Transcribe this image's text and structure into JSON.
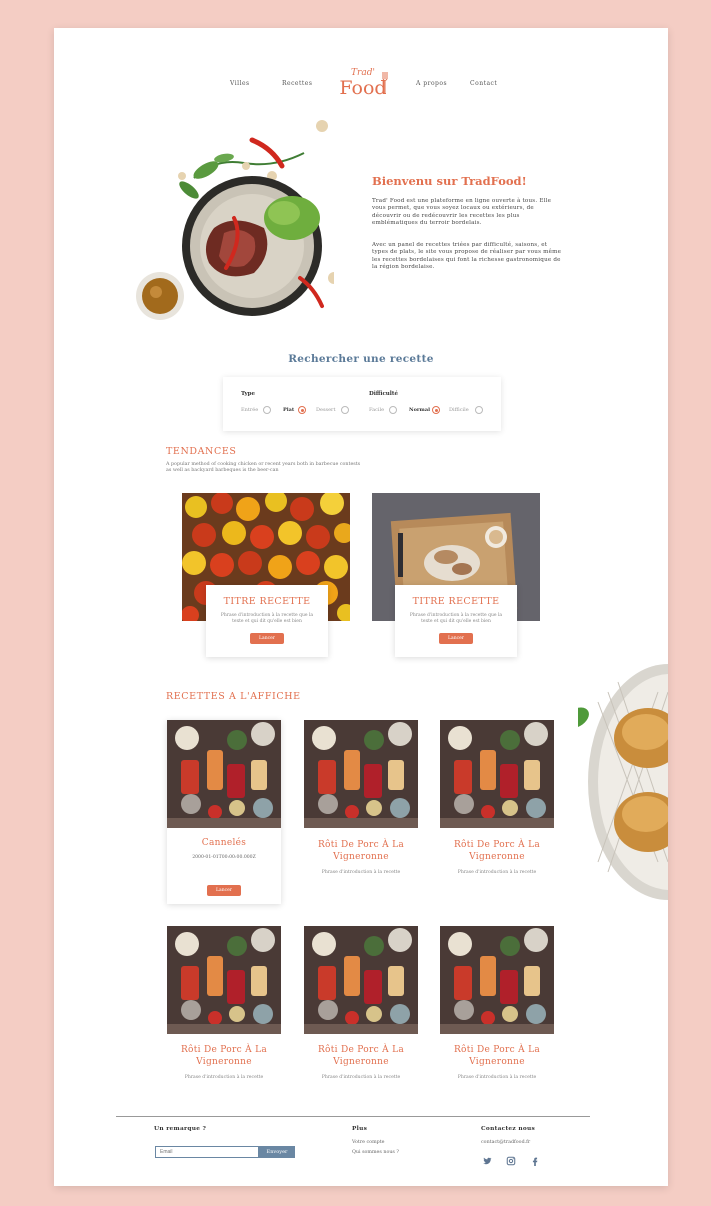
{
  "nav": {
    "items": [
      "Villes",
      "Recettes",
      "A propos",
      "Contact"
    ],
    "logo_top": "Trad'",
    "logo_bottom": "Food"
  },
  "hero": {
    "title": "Bienvenu sur TradFood!",
    "p1": "Trad' Food est une plateforme en ligne ouverte à tous. Elle vous permet, que vous soyez locaux ou extérieurs, de découvrir ou de redécouvrir les recettes les plus emblématiques du terroir bordelais.",
    "p2": "Avec un panel de recettes triées par difficulté, saisons, et types de plats, le site vous propose de réaliser par vous même les recettes bordelaises qui font la richesse gastronomique de la région bordelaise."
  },
  "search": {
    "title": "Rechercher une recette",
    "type_label": "Type",
    "type_options": [
      "Entrée",
      "Plat",
      "Dessert"
    ],
    "type_selected": "Plat",
    "difficulty_label": "Difficulté",
    "difficulty_options": [
      "Facile",
      "Normal",
      "Difficile"
    ],
    "difficulty_selected": "Normal"
  },
  "trends": {
    "title": "TENDANCES",
    "subtitle": "A popular method of cooking chicken or recent years both in barbecue contests as well as backyard barbeques is the beer-can",
    "cards": [
      {
        "title": "TITRE RECETTE",
        "desc": "Phrase d'introduction à la recette que la texte et qui dit qu'elle est bien",
        "button": "Lancer"
      },
      {
        "title": "TITRE RECETTE",
        "desc": "Phrase d'introduction à la recette que la texte et qui dit qu'elle est bien",
        "button": "Lancer"
      }
    ]
  },
  "featured": {
    "title": "RECETTES A L'AFFICHE",
    "first": {
      "title": "Cannelés",
      "date": "2000-01-01T00:00:00.000Z",
      "button": "Lancer"
    },
    "items": [
      {
        "title": "Rôti De Porc À La Vigneronne",
        "desc": "Phrase d'introduction à la recette"
      },
      {
        "title": "Rôti De Porc À La Vigneronne",
        "desc": "Phrase d'introduction à la recette"
      },
      {
        "title": "Rôti De Porc À La Vigneronne",
        "desc": "Phrase d'introduction à la recette"
      },
      {
        "title": "Rôti De Porc À La Vigneronne",
        "desc": "Phrase d'introduction à la recette"
      },
      {
        "title": "Rôti De Porc À La Vigneronne",
        "desc": "Phrase d'introduction à la recette"
      }
    ]
  },
  "footer": {
    "remark_title": "Un remarque ?",
    "email_placeholder": "Email",
    "send_label": "Envoyer",
    "plus_title": "Plus",
    "plus_links": [
      "Votre compte",
      "Qui sommes nous ?"
    ],
    "contact_title": "Contactez nous",
    "contact_email": "contact@tradfood.fr",
    "social_icons": [
      "twitter-icon",
      "instagram-icon",
      "facebook-icon"
    ]
  },
  "colors": {
    "accent": "#e2704f",
    "background": "#f4cdc4",
    "search_title": "#5b7a98",
    "footer_button": "#6a87a3"
  }
}
